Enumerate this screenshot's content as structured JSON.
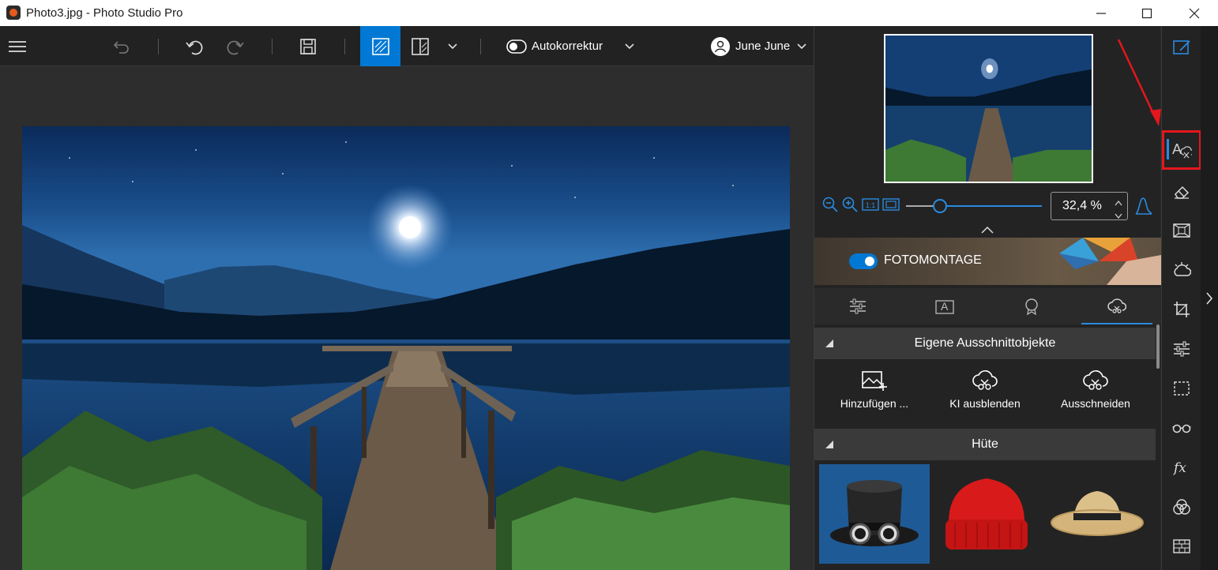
{
  "window": {
    "title": "Photo3.jpg - Photo Studio Pro"
  },
  "toolbar": {
    "autokorrektur_label": "Autokorrektur",
    "user_name": "June June"
  },
  "zoom": {
    "value": "32,4 %",
    "slider_fraction": 0.25
  },
  "banner": {
    "label": "FOTOMONTAGE",
    "toggle_on": true
  },
  "sections": {
    "own_cutouts": {
      "title": "Eigene Ausschnittobjekte",
      "actions": [
        {
          "label": "Hinzufügen ...",
          "icon": "add-image-icon"
        },
        {
          "label": "KI ausblenden",
          "icon": "ai-hide-icon"
        },
        {
          "label": "Ausschneiden",
          "icon": "cut-out-icon"
        }
      ]
    },
    "hats": {
      "title": "Hüte",
      "items": [
        "top-hat-with-goggles",
        "red-beanie",
        "straw-hat"
      ]
    }
  },
  "colors": {
    "accent": "#0078d4",
    "highlight": "#e3171d"
  }
}
